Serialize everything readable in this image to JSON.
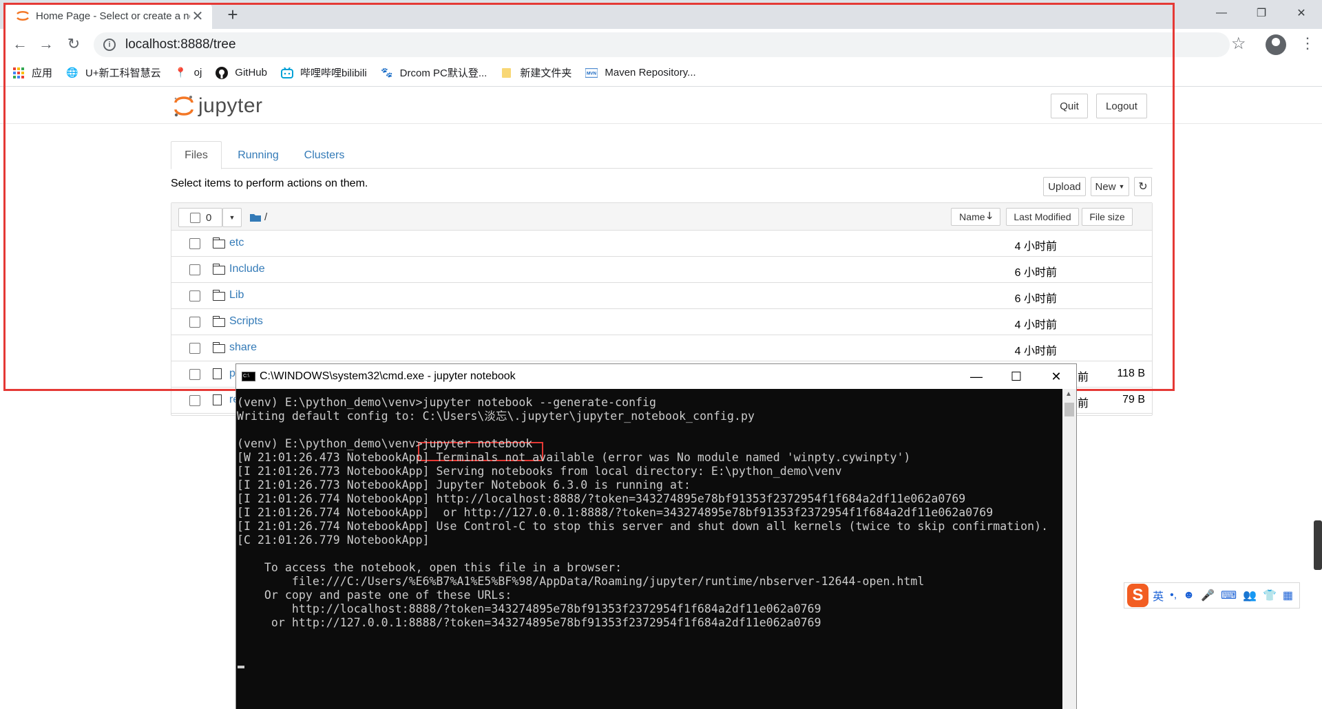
{
  "browser": {
    "tab_title": "Home Page - Select or create a notebook",
    "new_tab": "+",
    "tab_close": "✕",
    "url": "localhost:8888/tree",
    "window_controls": {
      "minimize": "—",
      "restore": "❐",
      "close": "✕"
    }
  },
  "bookmarks": [
    {
      "label": "应用",
      "icon": "apps-grid-icon"
    },
    {
      "label": "U+新工科智慧云",
      "icon": "globe-icon"
    },
    {
      "label": "oj",
      "icon": "pin-icon"
    },
    {
      "label": "GitHub",
      "icon": "github-icon"
    },
    {
      "label": "哔哩哔哩bilibili",
      "icon": "bilibili-icon"
    },
    {
      "label": "Drcom PC默认登...",
      "icon": "paw-icon"
    },
    {
      "label": "新建文件夹",
      "icon": "folder-icon"
    },
    {
      "label": "Maven Repository...",
      "icon": "mvn-icon"
    }
  ],
  "jupyter": {
    "logo_text": "jupyter",
    "quit_label": "Quit",
    "logout_label": "Logout",
    "tabs": [
      {
        "label": "Files"
      },
      {
        "label": "Running"
      },
      {
        "label": "Clusters"
      }
    ],
    "hint": "Select items to perform actions on them.",
    "upload_label": "Upload",
    "new_label": "New",
    "selected_count": "0",
    "breadcrumb": "/",
    "columns": {
      "name": "Name",
      "modified": "Last Modified",
      "size": "File size"
    },
    "files": [
      {
        "name": "etc",
        "type": "folder",
        "modified": "4 小时前",
        "size": ""
      },
      {
        "name": "Include",
        "type": "folder",
        "modified": "6 小时前",
        "size": ""
      },
      {
        "name": "Lib",
        "type": "folder",
        "modified": "6 小时前",
        "size": ""
      },
      {
        "name": "Scripts",
        "type": "folder",
        "modified": "4 小时前",
        "size": ""
      },
      {
        "name": "share",
        "type": "folder",
        "modified": "4 小时前",
        "size": ""
      },
      {
        "name": "p",
        "type": "file",
        "modified": "前",
        "size": "118 B"
      },
      {
        "name": "re",
        "type": "file",
        "modified": "前",
        "size": "79 B"
      }
    ]
  },
  "cmd": {
    "title": "C:\\WINDOWS\\system32\\cmd.exe - jupyter  notebook",
    "icon_text": "C:\\",
    "lines": [
      "(venv) E:\\python_demo\\venv>jupyter notebook --generate-config",
      "Writing default config to: C:\\Users\\淡忘\\.jupyter\\jupyter_notebook_config.py",
      "",
      "(venv) E:\\python_demo\\venv>jupyter notebook",
      "[W 21:01:26.473 NotebookApp] Terminals not available (error was No module named 'winpty.cywinpty')",
      "[I 21:01:26.773 NotebookApp] Serving notebooks from local directory: E:\\python_demo\\venv",
      "[I 21:01:26.773 NotebookApp] Jupyter Notebook 6.3.0 is running at:",
      "[I 21:01:26.774 NotebookApp] http://localhost:8888/?token=343274895e78bf91353f2372954f1f684a2df11e062a0769",
      "[I 21:01:26.774 NotebookApp]  or http://127.0.0.1:8888/?token=343274895e78bf91353f2372954f1f684a2df11e062a0769",
      "[I 21:01:26.774 NotebookApp] Use Control-C to stop this server and shut down all kernels (twice to skip confirmation).",
      "[C 21:01:26.779 NotebookApp]",
      "",
      "    To access the notebook, open this file in a browser:",
      "        file:///C:/Users/%E6%B7%A1%E5%BF%98/AppData/Roaming/jupyter/runtime/nbserver-12644-open.html",
      "    Or copy and paste one of these URLs:",
      "        http://localhost:8888/?token=343274895e78bf91353f2372954f1f684a2df11e062a0769",
      "     or http://127.0.0.1:8888/?token=343274895e78bf91353f2372954f1f684a2df11e062a0769"
    ]
  },
  "ime": {
    "logo": "S",
    "lang": "英",
    "punct": "•,",
    "items": [
      "☻",
      "🎤",
      "⌨",
      "👥",
      "👕",
      "▦"
    ]
  },
  "colors": {
    "highlight": "#e53935",
    "link": "#337ab7",
    "console_bg": "#0c0c0c"
  }
}
